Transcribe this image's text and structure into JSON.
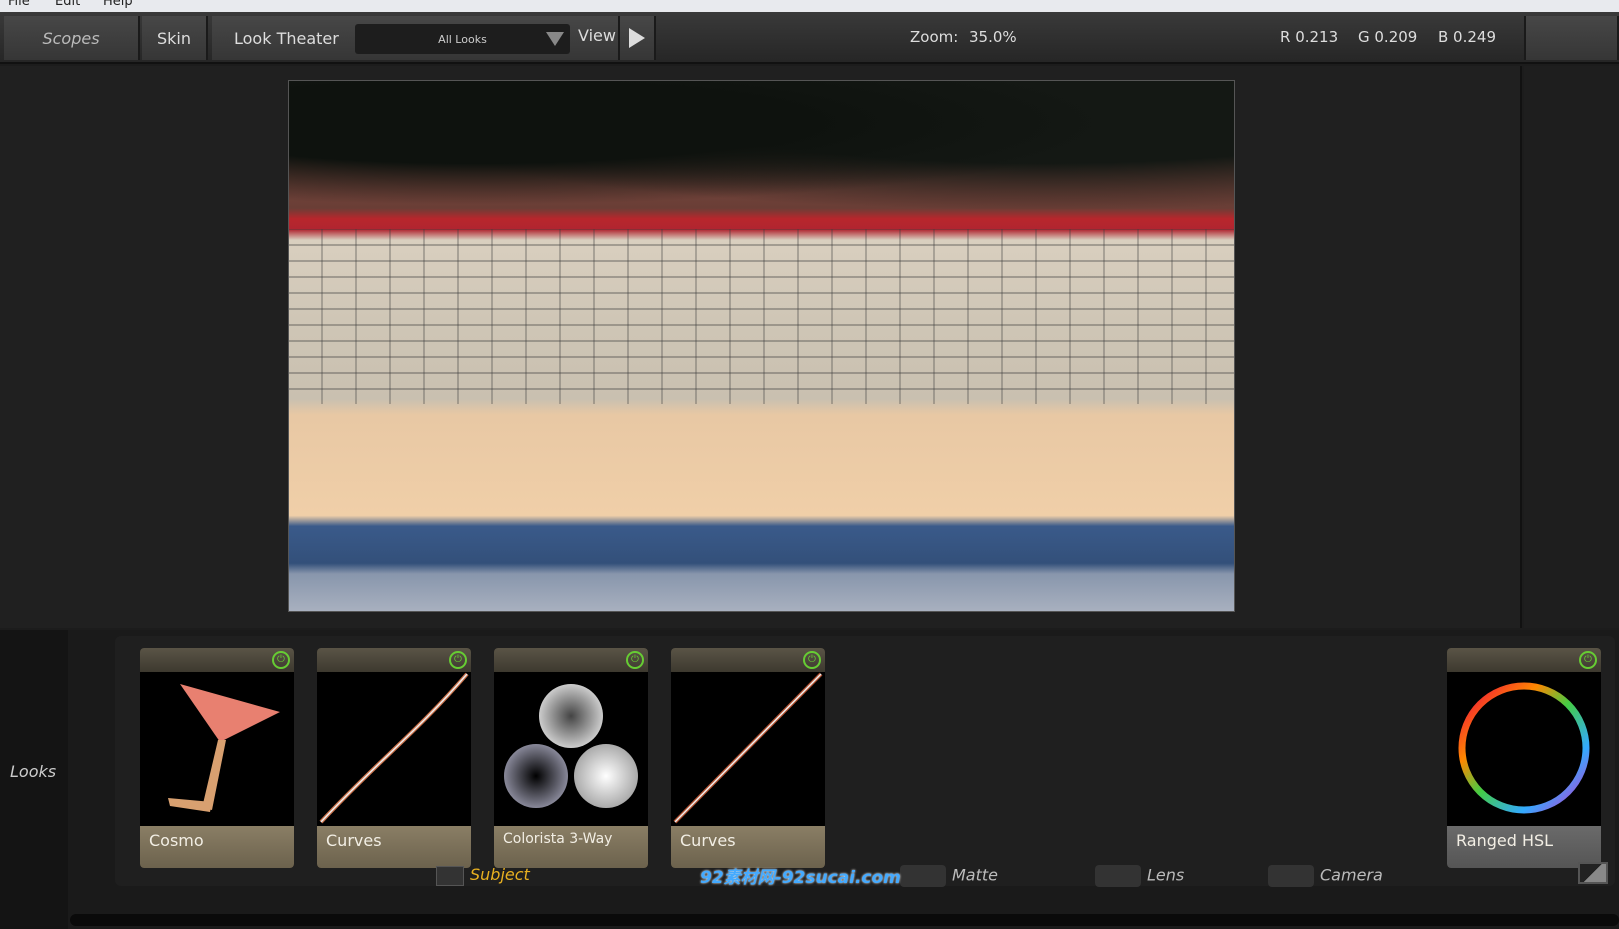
{
  "menu": [
    "File",
    "Edit",
    "Help"
  ],
  "toolbar": {
    "scopes": "Scopes",
    "skin": "Skin",
    "look_theater": "Look Theater",
    "looks_dropdown": "All Looks",
    "view": "View",
    "zoom_label": "Zoom:",
    "zoom_value": "35.0%",
    "r": "R 0.213",
    "g": "G 0.209",
    "b": "B 0.249"
  },
  "sidebar": {
    "looks": "Looks"
  },
  "tools": [
    {
      "name": "Cosmo"
    },
    {
      "name": "Curves"
    },
    {
      "name": "Colorista 3-Way"
    },
    {
      "name": "Curves"
    },
    {
      "name": "Ranged HSL"
    }
  ],
  "categories": {
    "subject": "Subject",
    "matte": "Matte",
    "lens": "Lens",
    "camera": "Camera"
  },
  "colors": {
    "accent": "#e8b020",
    "power": "#66cc33",
    "card_foot": "#7a705a"
  },
  "watermark": "92素材网-92sucai.com"
}
